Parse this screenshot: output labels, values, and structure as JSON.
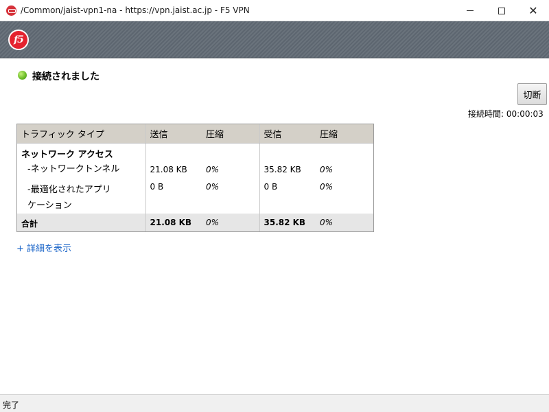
{
  "window": {
    "title": "/Common/jaist-vpn1-na - https://vpn.jaist.ac.jp - F5 VPN",
    "minimize_label": "",
    "close_glyph": "✕"
  },
  "brand": {
    "logo_text": "f5"
  },
  "status": {
    "text": "接続されました",
    "indicator_color": "#6fbf2a"
  },
  "actions": {
    "disconnect_label": "切断"
  },
  "duration": {
    "label": "接続時間:",
    "value": "00:00:03"
  },
  "traffic_table": {
    "headers": [
      "トラフィック タイプ",
      "送信",
      "圧縮",
      "受信",
      "圧縮"
    ],
    "group": {
      "name": "ネットワーク アクセス"
    },
    "rows": [
      {
        "name": "-ネットワークトンネル",
        "sent": "21.08 KB",
        "sent_comp": "0%",
        "recv": "35.82 KB",
        "recv_comp": "0%"
      },
      {
        "name_line1": "-最適化されたアプリ",
        "name_line2": "ケーション",
        "sent": "0 B",
        "sent_comp": "0%",
        "recv": "0 B",
        "recv_comp": "0%"
      }
    ],
    "total": {
      "name": "合計",
      "sent": "21.08 KB",
      "sent_comp": "0%",
      "recv": "35.82 KB",
      "recv_comp": "0%"
    }
  },
  "details_link": "+ 詳細を表示",
  "statusbar": {
    "text": "完了"
  }
}
